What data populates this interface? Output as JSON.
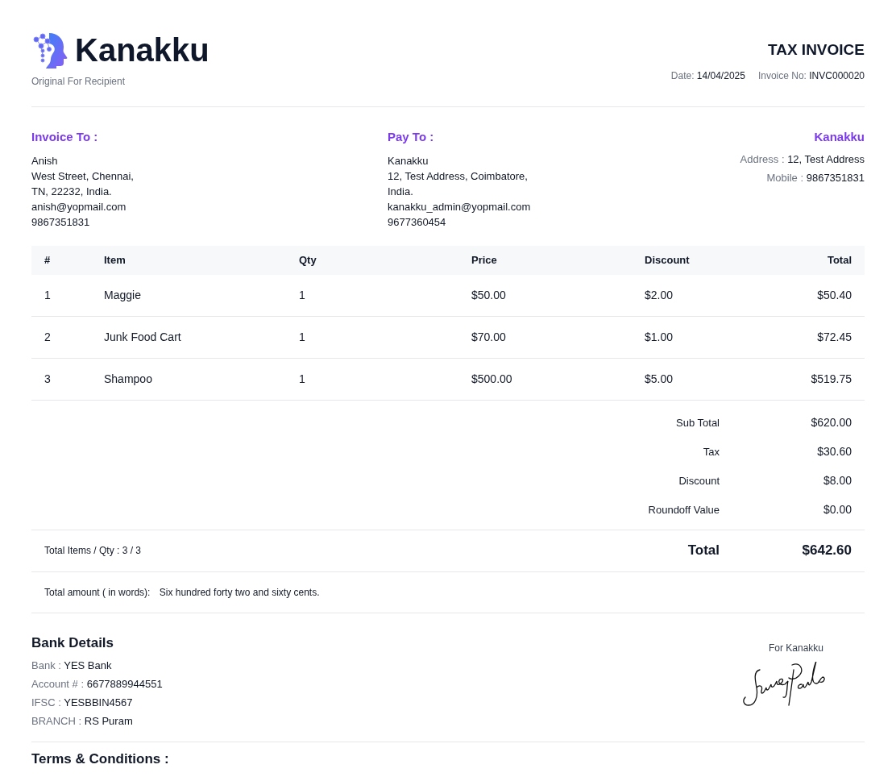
{
  "brand": {
    "name": "Kanakku",
    "subtitle": "Original For Recipient"
  },
  "document": {
    "title": "TAX INVOICE",
    "date_label": "Date:",
    "date": "14/04/2025",
    "number_label": "Invoice No:",
    "number": "INVC000020"
  },
  "invoice_to": {
    "heading": "Invoice To :",
    "lines": [
      "Anish",
      "West Street, Chennai,",
      "TN, 22232, India.",
      "anish@yopmail.com",
      "9867351831"
    ]
  },
  "pay_to": {
    "heading": "Pay To :",
    "lines": [
      "Kanakku",
      "12, Test Address, Coimbatore,",
      "India.",
      "kanakku_admin@yopmail.com",
      "9677360454"
    ]
  },
  "company": {
    "name": "Kanakku",
    "fields": [
      {
        "label": "Address :",
        "value": "12, Test Address"
      },
      {
        "label": "Mobile :",
        "value": "9867351831"
      }
    ]
  },
  "table": {
    "columns": [
      "#",
      "Item",
      "Qty",
      "Price",
      "Discount",
      "Total"
    ],
    "rows": [
      [
        "1",
        "Maggie",
        "1",
        "$50.00",
        "$2.00",
        "$50.40"
      ],
      [
        "2",
        "Junk Food Cart",
        "1",
        "$70.00",
        "$1.00",
        "$72.45"
      ],
      [
        "3",
        "Shampoo",
        "1",
        "$500.00",
        "$5.00",
        "$519.75"
      ]
    ]
  },
  "summary": [
    {
      "label": "Sub Total",
      "value": "$620.00"
    },
    {
      "label": "Tax",
      "value": "$30.60"
    },
    {
      "label": "Discount",
      "value": "$8.00"
    },
    {
      "label": "Roundoff Value",
      "value": "$0.00"
    }
  ],
  "totals": {
    "items_label": "Total Items / Qty : 3 / 3",
    "total_label": "Total",
    "total_value": "$642.60"
  },
  "amount_in_words": {
    "label": "Total amount ( in words):",
    "value": "Six hundred forty two and sixty cents."
  },
  "bank": {
    "heading": "Bank Details",
    "fields": [
      {
        "label": "Bank :",
        "value": "YES Bank"
      },
      {
        "label": "Account # :",
        "value": "6677889944551"
      },
      {
        "label": "IFSC  :",
        "value": "YESBBIN4567"
      },
      {
        "label": "BRANCH  :",
        "value": "RS Puram"
      }
    ]
  },
  "signature": {
    "caption": "For Kanakku"
  },
  "terms": {
    "heading": "Terms & Conditions :"
  }
}
